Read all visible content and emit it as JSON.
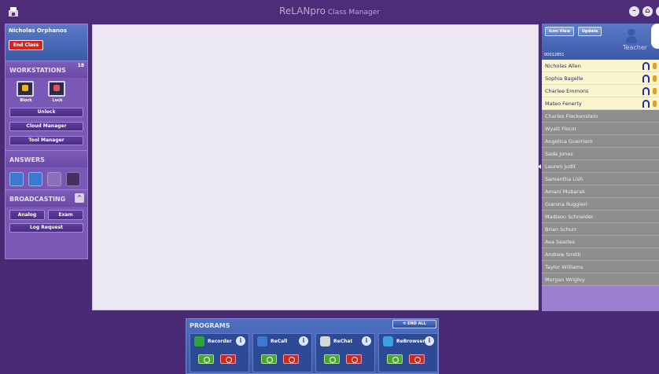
{
  "titlebar": {
    "app_name": "ReLANpro",
    "subtitle": "Class Manager"
  },
  "left": {
    "teacher_name": "Nicholas Orphanos",
    "end_class_label": "End Class",
    "workstations": {
      "title": "WORKSTATIONS",
      "count": "18",
      "block_label": "Block",
      "lock_label": "Lock",
      "unlock_label": "Unlock",
      "cloud_manager_label": "Cloud Manager",
      "tool_manager_label": "Tool Manager"
    },
    "answers": {
      "title": "ANSWERS"
    },
    "broadcasting": {
      "title": "BROADCASTING",
      "analog_label": "Analog",
      "exam_label": "Exam",
      "log_request_label": "Log Request"
    }
  },
  "right": {
    "icon_view_label": "Icon View",
    "update_label": "Update",
    "teacher_label": "Teacher",
    "station_id": "00012851",
    "students": [
      {
        "name": "Nicholas Allen",
        "online": true
      },
      {
        "name": "Sophia Bagelle",
        "online": true
      },
      {
        "name": "Charlee Emmons",
        "online": true
      },
      {
        "name": "Mateo Fenerty",
        "online": true
      },
      {
        "name": "Charles Fleckenstein",
        "online": false
      },
      {
        "name": "Wyatt Fiscor",
        "online": false
      },
      {
        "name": "Angelica Guerriero",
        "online": false
      },
      {
        "name": "Sade Jones",
        "online": false
      },
      {
        "name": "Lauren Judit",
        "online": false
      },
      {
        "name": "Samantha Lish",
        "online": false
      },
      {
        "name": "Amani Mubarak",
        "online": false
      },
      {
        "name": "Gianina Ruggieri",
        "online": false
      },
      {
        "name": "Madison Schneider",
        "online": false
      },
      {
        "name": "Brian Schurr",
        "online": false
      },
      {
        "name": "Ava Searles",
        "online": false
      },
      {
        "name": "Andrew Smith",
        "online": false
      },
      {
        "name": "Taylor Williams",
        "online": false
      },
      {
        "name": "Morgan Wrigley",
        "online": false
      }
    ]
  },
  "programs": {
    "title": "PROGRAMS",
    "end_all_label": "END ALL",
    "items": [
      {
        "name": "Recorder",
        "icon": "recorder-icon",
        "color": "#2fa33a"
      },
      {
        "name": "ReCall",
        "icon": "recall-icon",
        "color": "#3a7ad0"
      },
      {
        "name": "ReChat",
        "icon": "rechat-icon",
        "color": "#d8d8d8"
      },
      {
        "name": "ReBrowser",
        "icon": "rebrowser-icon",
        "color": "#3aa0e0"
      }
    ]
  },
  "colors": {
    "background": "#4a2a74",
    "panel": "#7a58b5",
    "accent_blue": "#3b5aa8",
    "online_row": "#fbf5cf",
    "offline_row": "#8e8e8e",
    "end_class": "#d9241b"
  }
}
